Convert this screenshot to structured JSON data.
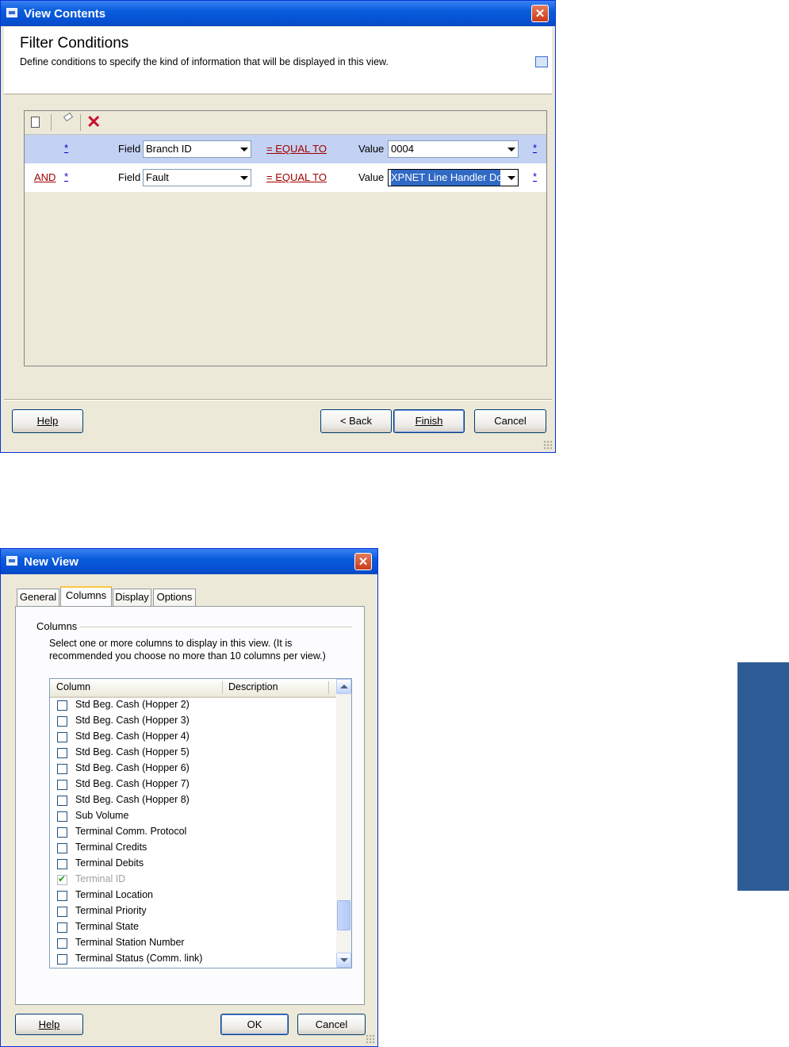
{
  "top_window": {
    "title": "View Contents",
    "header_title": "Filter Conditions",
    "header_desc": "Define conditions to specify the kind of information that will be displayed in this view.",
    "toolbar": {
      "new_icon": "new-document-icon",
      "edit_icon": "eraser-icon",
      "delete_icon": "delete-x-icon"
    },
    "conditions": [
      {
        "connector": "",
        "star": "*",
        "field_label": "Field",
        "field": "Branch ID",
        "operator": "= EQUAL TO",
        "value_label": "Value",
        "value": "0004",
        "end_star": "*"
      },
      {
        "connector": "AND",
        "star": "*",
        "field_label": "Field",
        "field": "Fault",
        "operator": "= EQUAL TO",
        "value_label": "Value",
        "value": "XPNET Line Handler Do",
        "end_star": "*"
      }
    ],
    "buttons": {
      "help": "Help",
      "back": "< Back",
      "finish": "Finish",
      "cancel": "Cancel"
    }
  },
  "bottom_window": {
    "title": "New View",
    "tabs": [
      "General",
      "Columns",
      "Display",
      "Options"
    ],
    "active_tab": "Columns",
    "group_label": "Columns",
    "instruction": "Select one or more columns to display in this view. (It is recommended you choose no more than 10 columns per view.)",
    "list_headers": {
      "column": "Column",
      "description": "Description"
    },
    "items": [
      {
        "label": "Std Beg. Cash  (Hopper 2)",
        "checked": false
      },
      {
        "label": "Std Beg. Cash  (Hopper 3)",
        "checked": false
      },
      {
        "label": "Std Beg. Cash  (Hopper 4)",
        "checked": false
      },
      {
        "label": "Std Beg. Cash  (Hopper 5)",
        "checked": false
      },
      {
        "label": "Std Beg. Cash  (Hopper 6)",
        "checked": false
      },
      {
        "label": "Std Beg. Cash  (Hopper 7)",
        "checked": false
      },
      {
        "label": "Std Beg. Cash  (Hopper 8)",
        "checked": false
      },
      {
        "label": "Sub Volume",
        "checked": false
      },
      {
        "label": "Terminal Comm. Protocol",
        "checked": false
      },
      {
        "label": "Terminal Credits",
        "checked": false
      },
      {
        "label": "Terminal Debits",
        "checked": false
      },
      {
        "label": "Terminal ID",
        "checked": true
      },
      {
        "label": "Terminal Location",
        "checked": false
      },
      {
        "label": "Terminal Priority",
        "checked": false
      },
      {
        "label": "Terminal State",
        "checked": false
      },
      {
        "label": "Terminal Station Number",
        "checked": false
      },
      {
        "label": "Terminal Status (Comm. link)",
        "checked": false
      }
    ],
    "buttons": {
      "help": "Help",
      "ok": "OK",
      "cancel": "Cancel"
    }
  },
  "colors": {
    "titlebar": "#0a5cdc",
    "dialog_bg": "#ece9d8",
    "selected_row": "#c3d1f2",
    "side_tab": "#2e5c96"
  }
}
